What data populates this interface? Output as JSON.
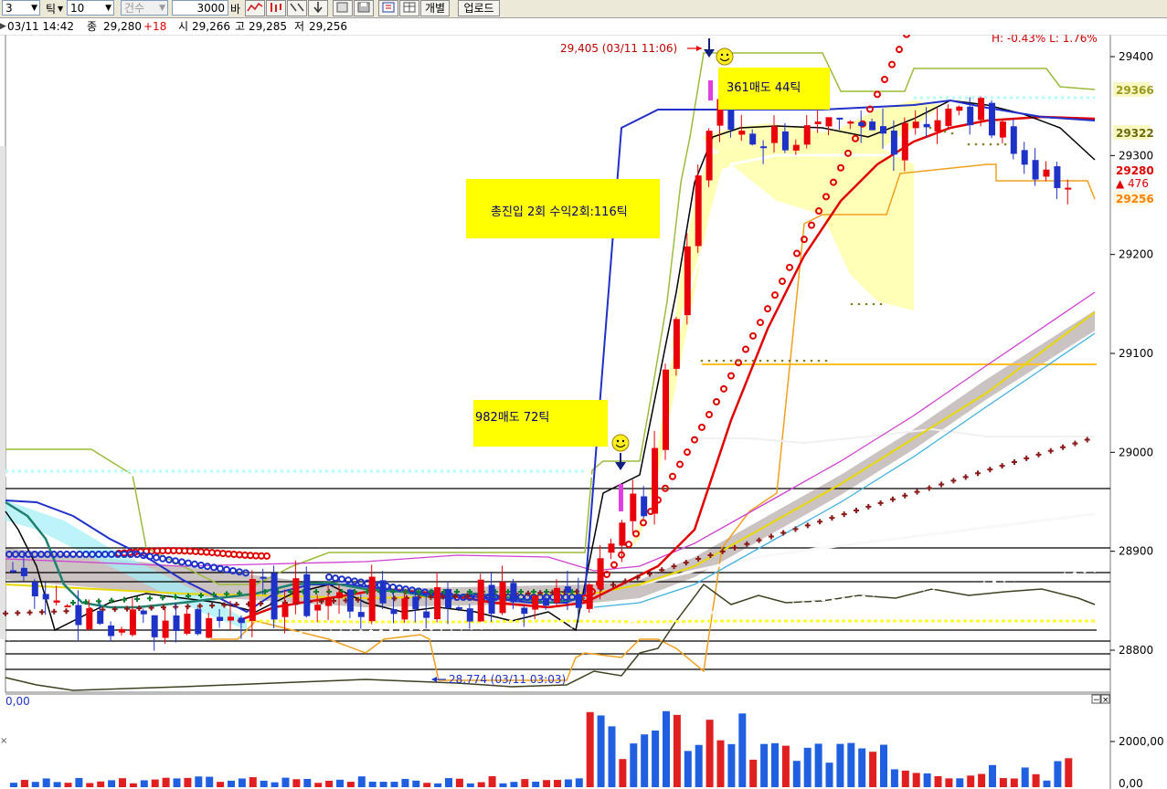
{
  "toolbar": {
    "count_value": "3",
    "unit_label": "틱",
    "interval_value": "10",
    "type_select": "건수",
    "qty_value": "3000",
    "bar_label": "바",
    "separate_button": "개별",
    "upload_button": "업로드"
  },
  "info": {
    "date_time": "03/11 14:42",
    "close_label": "종",
    "close_value": "29,280",
    "change_value": "+18",
    "open_label": "시",
    "open_value": "29,266",
    "high_label": "고",
    "high_value": "29,285",
    "low_label": "저",
    "low_value": "29,256"
  },
  "chart": {
    "hl_text": "H: -0.43%  L: 1.76%",
    "high_marker": "29,405 (03/11 11:06)",
    "low_marker": "28,774 (03/11 03:03)",
    "annotation_total": "총진입 2회    수익2회:116틱",
    "annotation_sell1": "361매도 44틱",
    "annotation_sell2": "982매도 72틱",
    "price_ticks": [
      "29400",
      "29300",
      "29200",
      "29100",
      "29000",
      "28900",
      "28800"
    ],
    "badge_green_high": "29366",
    "badge_green_mid": "29322",
    "badge_current": "29280",
    "badge_delta": "▲ 476",
    "badge_low": "29256",
    "volume_zero_left": "0,00",
    "volume_tick_2000": "2000,00",
    "volume_tick_0": "0,00"
  },
  "colors": {
    "bull": "#e8000a",
    "bear": "#1e32c8",
    "annotation_box": "#ffff00",
    "volume_up": "#e02020",
    "volume_down": "#2060e0"
  }
}
